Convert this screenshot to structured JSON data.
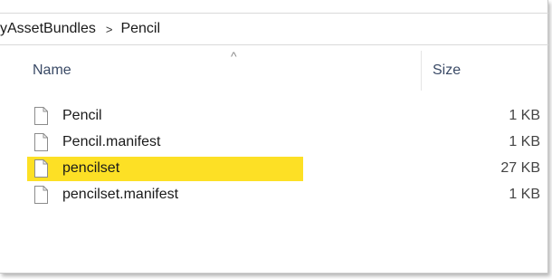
{
  "breadcrumb": {
    "parent": "yAssetBundles",
    "separator": ">",
    "current": "Pencil"
  },
  "columns": {
    "name": "Name",
    "size": "Size",
    "sort_indicator": "^"
  },
  "files": [
    {
      "name": "Pencil",
      "size": "1 KB",
      "highlighted": false
    },
    {
      "name": "Pencil.manifest",
      "size": "1 KB",
      "highlighted": false
    },
    {
      "name": "pencilset",
      "size": "27 KB",
      "highlighted": true
    },
    {
      "name": "pencilset.manifest",
      "size": "1 KB",
      "highlighted": false
    }
  ],
  "colors": {
    "highlight": "#fde025",
    "header_text": "#3a4a66"
  },
  "icons": {
    "file": "blank-file-icon"
  }
}
